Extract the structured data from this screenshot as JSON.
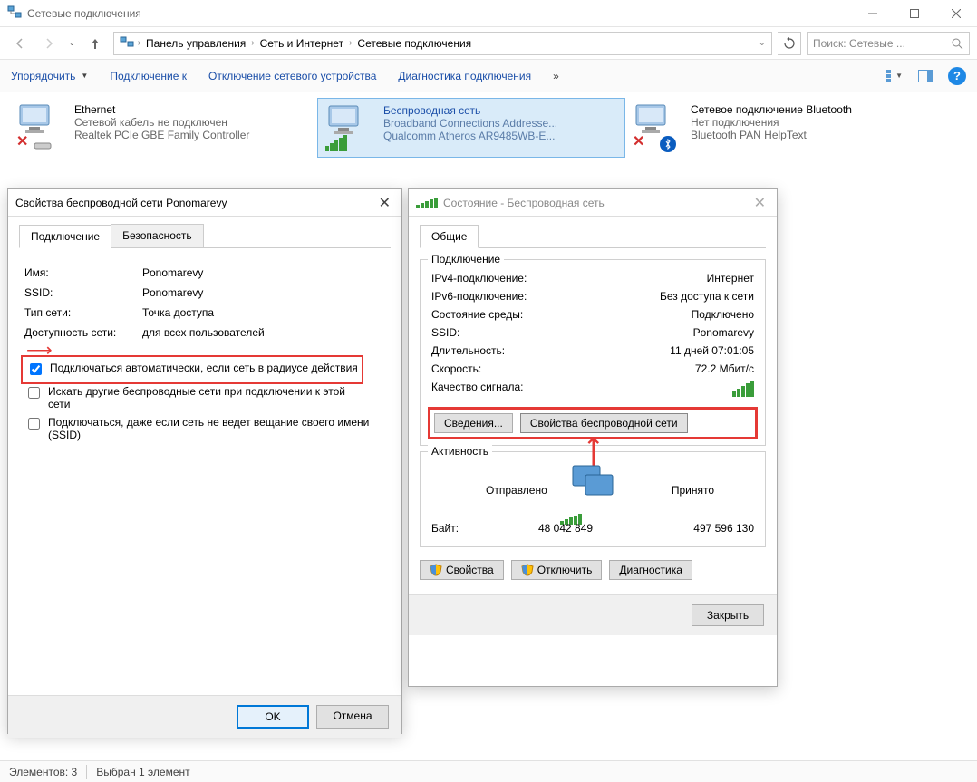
{
  "window": {
    "title": "Сетевые подключения"
  },
  "breadcrumb": {
    "root": "Панель управления",
    "mid": "Сеть и Интернет",
    "leaf": "Сетевые подключения"
  },
  "search": {
    "placeholder": "Поиск: Сетевые ..."
  },
  "toolbar": {
    "organize": "Упорядочить",
    "connect": "Подключение к",
    "disable": "Отключение сетевого устройства",
    "diagnose": "Диагностика подключения"
  },
  "connections": {
    "ethernet": {
      "name": "Ethernet",
      "status": "Сетевой кабель не подключен",
      "device": "Realtek PCIe GBE Family Controller"
    },
    "wifi": {
      "name": "Беспроводная сеть",
      "status": "Broadband Connections Addresse...",
      "device": "Qualcomm Atheros AR9485WB-E..."
    },
    "bluetooth": {
      "name": "Сетевое подключение Bluetooth",
      "status": "Нет подключения",
      "device": "Bluetooth PAN HelpText"
    }
  },
  "props_dialog": {
    "title": "Свойства беспроводной сети Ponomarevy",
    "tab_connection": "Подключение",
    "tab_security": "Безопасность",
    "name_lbl": "Имя:",
    "name_val": "Ponomarevy",
    "ssid_lbl": "SSID:",
    "ssid_val": "Ponomarevy",
    "nettype_lbl": "Тип сети:",
    "nettype_val": "Точка доступа",
    "avail_lbl": "Доступность сети:",
    "avail_val": "для всех пользователей",
    "cb_auto": "Подключаться автоматически, если сеть в радиусе действия",
    "cb_search": "Искать другие беспроводные сети при подключении к этой сети",
    "cb_hidden": "Подключаться, даже если сеть не ведет вещание своего имени (SSID)",
    "ok": "OK",
    "cancel": "Отмена"
  },
  "status_dialog": {
    "title": "Состояние - Беспроводная сеть",
    "tab_general": "Общие",
    "group_conn": "Подключение",
    "ipv4_lbl": "IPv4-подключение:",
    "ipv4_val": "Интернет",
    "ipv6_lbl": "IPv6-подключение:",
    "ipv6_val": "Без доступа к сети",
    "media_lbl": "Состояние среды:",
    "media_val": "Подключено",
    "ssid_lbl": "SSID:",
    "ssid_val": "Ponomarevy",
    "dur_lbl": "Длительность:",
    "dur_val": "11 дней 07:01:05",
    "speed_lbl": "Скорость:",
    "speed_val": "72.2 Мбит/с",
    "signal_lbl": "Качество сигнала:",
    "details_btn": "Сведения...",
    "wprops_btn": "Свойства беспроводной сети",
    "group_activity": "Активность",
    "sent_lbl": "Отправлено",
    "recv_lbl": "Принято",
    "bytes_lbl": "Байт:",
    "sent_bytes": "48 042 849",
    "recv_bytes": "497 596 130",
    "props_btn": "Свойства",
    "disable_btn": "Отключить",
    "diag_btn": "Диагностика",
    "close_btn": "Закрыть"
  },
  "statusbar": {
    "count": "Элементов: 3",
    "sel": "Выбран 1 элемент"
  }
}
